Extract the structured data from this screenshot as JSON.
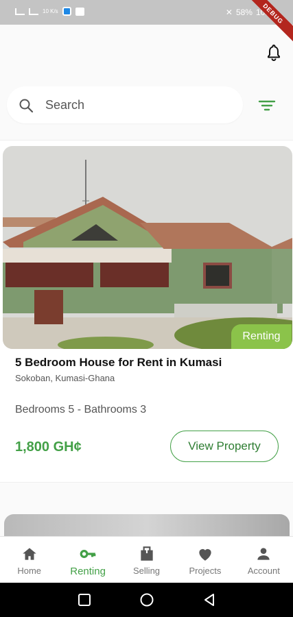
{
  "status_bar": {
    "network_label": "10\nK/s",
    "battery_percent": "58%",
    "time": "10:06",
    "debug_label": "DEBUG"
  },
  "search": {
    "placeholder": "Search"
  },
  "property": {
    "status": "Renting",
    "title": "5 Bedroom House for Rent in Kumasi",
    "location": "Sokoban, Kumasi-Ghana",
    "specs": "Bedrooms 5 - Bathrooms 3",
    "price": "1,800 GH¢",
    "cta_label": "View Property"
  },
  "bottom_nav": {
    "items": [
      {
        "label": "Home",
        "icon": "home-icon"
      },
      {
        "label": "Renting",
        "icon": "key-icon",
        "active": true
      },
      {
        "label": "Selling",
        "icon": "briefcase-icon"
      },
      {
        "label": "Projects",
        "icon": "heart-icon"
      },
      {
        "label": "Account",
        "icon": "person-icon"
      }
    ]
  },
  "colors": {
    "accent": "#43a047",
    "tag": "#8bc34a",
    "status_bar": "#c4c4c4"
  }
}
